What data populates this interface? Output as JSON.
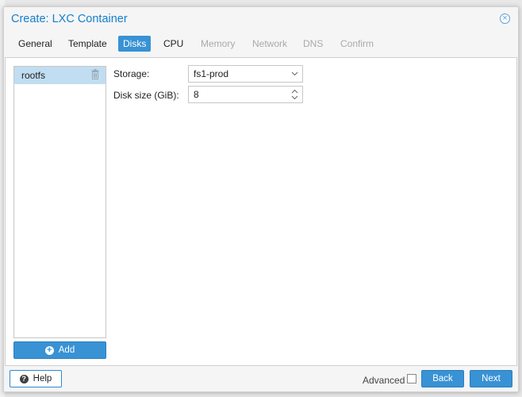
{
  "window": {
    "title": "Create: LXC Container"
  },
  "tabs": [
    {
      "label": "General",
      "state": "normal"
    },
    {
      "label": "Template",
      "state": "normal"
    },
    {
      "label": "Disks",
      "state": "active"
    },
    {
      "label": "CPU",
      "state": "normal"
    },
    {
      "label": "Memory",
      "state": "disabled"
    },
    {
      "label": "Network",
      "state": "disabled"
    },
    {
      "label": "DNS",
      "state": "disabled"
    },
    {
      "label": "Confirm",
      "state": "disabled"
    }
  ],
  "disks": {
    "items": [
      {
        "label": "rootfs",
        "selected": true
      }
    ],
    "add_label": "Add"
  },
  "form": {
    "storage_label": "Storage:",
    "storage_value": "fs1-prod",
    "disk_size_label": "Disk size (GiB):",
    "disk_size_value": "8"
  },
  "footer": {
    "help_label": "Help",
    "advanced_label": "Advanced",
    "advanced_checked": false,
    "back_label": "Back",
    "next_label": "Next"
  },
  "colors": {
    "accent": "#3892d4",
    "title": "#157fcc",
    "selected_row": "#c1ddf1",
    "disabled_text": "#aaaaaa"
  }
}
